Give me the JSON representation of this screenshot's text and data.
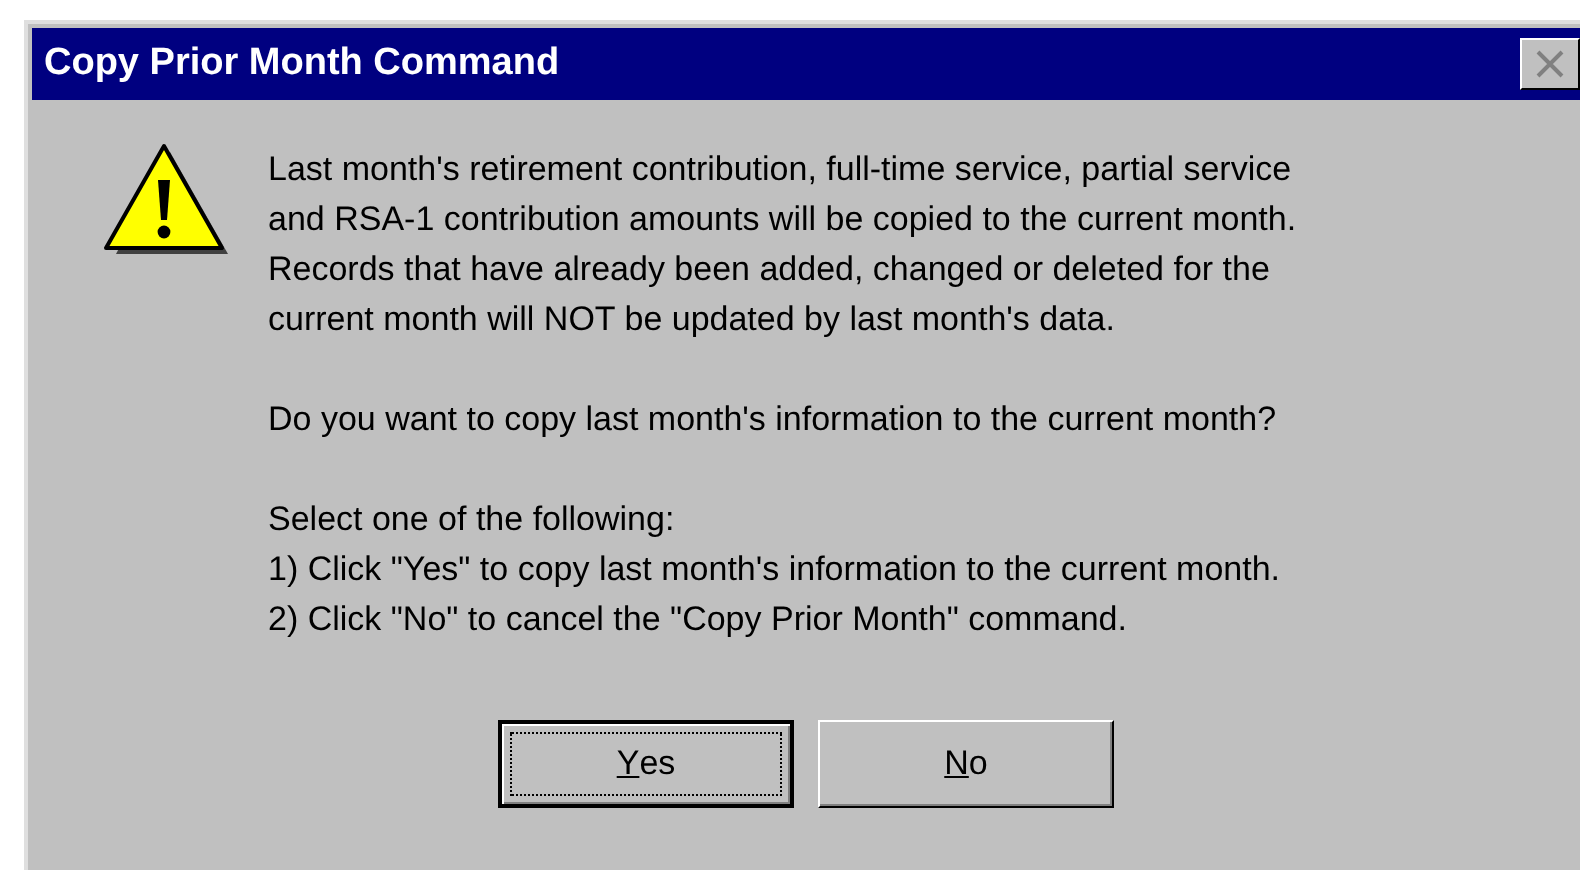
{
  "window": {
    "title": "Copy Prior Month Command"
  },
  "message": {
    "paragraphs": [
      {
        "lines": [
          "Last month's retirement contribution, full-time service, partial service",
          "and RSA-1 contribution amounts will be copied to the current month.",
          "Records that have already been added, changed or deleted for the",
          "current month will NOT be updated by last month's data."
        ]
      },
      {
        "lines": [
          "Do you want to copy last month's information to the current month?"
        ]
      },
      {
        "lines": [
          "Select one of the following:",
          "1) Click \"Yes\" to copy last month's information to the current month.",
          "2) Click \"No\" to cancel the \"Copy Prior Month\" command."
        ]
      }
    ]
  },
  "buttons": [
    {
      "label": "Yes",
      "default": true
    },
    {
      "label": "No",
      "default": false
    }
  ]
}
